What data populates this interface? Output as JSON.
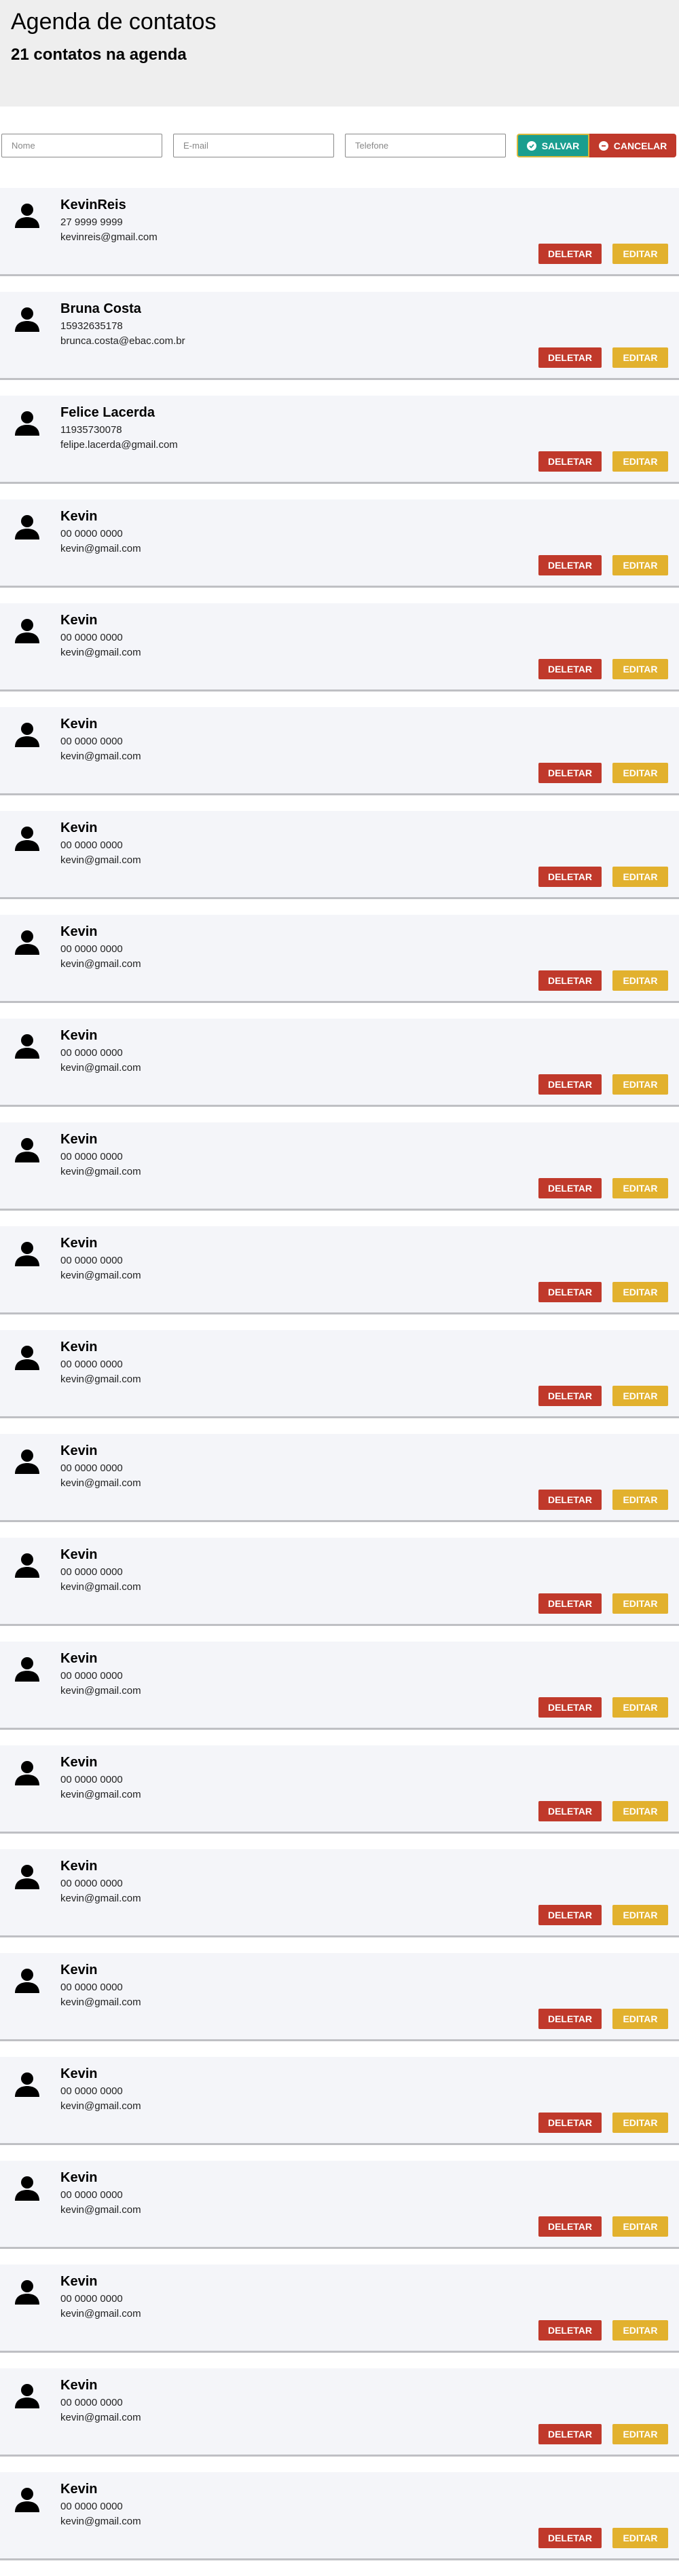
{
  "header": {
    "title": "Agenda de contatos",
    "count_text": "21 contatos na agenda"
  },
  "form": {
    "name_placeholder": "Nome",
    "email_placeholder": "E-mail",
    "phone_placeholder": "Telefone",
    "save_label": "SALVAR",
    "cancel_label": "CANCELAR"
  },
  "buttons": {
    "delete_label": "DELETAR",
    "edit_label": "EDITAR"
  },
  "colors": {
    "save": "#1a9e8f",
    "cancel": "#c0392b",
    "delete": "#c0392b",
    "edit": "#e2b12e"
  },
  "contacts": [
    {
      "name": "KevinReis",
      "phone": "27 9999 9999",
      "email": "kevinreis@gmail.com"
    },
    {
      "name": "Bruna Costa",
      "phone": "15932635178",
      "email": "brunca.costa@ebac.com.br"
    },
    {
      "name": "Felice Lacerda",
      "phone": "11935730078",
      "email": "felipe.lacerda@gmail.com"
    },
    {
      "name": "Kevin",
      "phone": "00 0000 0000",
      "email": "kevin@gmail.com"
    },
    {
      "name": "Kevin",
      "phone": "00 0000 0000",
      "email": "kevin@gmail.com"
    },
    {
      "name": "Kevin",
      "phone": "00 0000 0000",
      "email": "kevin@gmail.com"
    },
    {
      "name": "Kevin",
      "phone": "00 0000 0000",
      "email": "kevin@gmail.com"
    },
    {
      "name": "Kevin",
      "phone": "00 0000 0000",
      "email": "kevin@gmail.com"
    },
    {
      "name": "Kevin",
      "phone": "00 0000 0000",
      "email": "kevin@gmail.com"
    },
    {
      "name": "Kevin",
      "phone": "00 0000 0000",
      "email": "kevin@gmail.com"
    },
    {
      "name": "Kevin",
      "phone": "00 0000 0000",
      "email": "kevin@gmail.com"
    },
    {
      "name": "Kevin",
      "phone": "00 0000 0000",
      "email": "kevin@gmail.com"
    },
    {
      "name": "Kevin",
      "phone": "00 0000 0000",
      "email": "kevin@gmail.com"
    },
    {
      "name": "Kevin",
      "phone": "00 0000 0000",
      "email": "kevin@gmail.com"
    },
    {
      "name": "Kevin",
      "phone": "00 0000 0000",
      "email": "kevin@gmail.com"
    },
    {
      "name": "Kevin",
      "phone": "00 0000 0000",
      "email": "kevin@gmail.com"
    },
    {
      "name": "Kevin",
      "phone": "00 0000 0000",
      "email": "kevin@gmail.com"
    },
    {
      "name": "Kevin",
      "phone": "00 0000 0000",
      "email": "kevin@gmail.com"
    },
    {
      "name": "Kevin",
      "phone": "00 0000 0000",
      "email": "kevin@gmail.com"
    },
    {
      "name": "Kevin",
      "phone": "00 0000 0000",
      "email": "kevin@gmail.com"
    },
    {
      "name": "Kevin",
      "phone": "00 0000 0000",
      "email": "kevin@gmail.com"
    },
    {
      "name": "Kevin",
      "phone": "00 0000 0000",
      "email": "kevin@gmail.com"
    },
    {
      "name": "Kevin",
      "phone": "00 0000 0000",
      "email": "kevin@gmail.com"
    }
  ]
}
